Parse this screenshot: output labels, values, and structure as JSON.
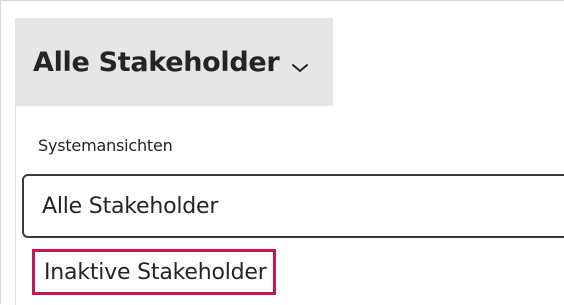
{
  "view_selector": {
    "label": "Alle Stakeholder",
    "chevron_icon": "chevron-down-icon"
  },
  "dropdown": {
    "group_header": "Systemansichten",
    "options": [
      {
        "label": "Alle Stakeholder",
        "state": "selected"
      },
      {
        "label": "Inaktive Stakeholder",
        "state": "highlighted"
      }
    ]
  },
  "colors": {
    "selector_background": "#e6e6e6",
    "highlight_border": "#c2185b",
    "selected_border": "#3a3a3a"
  }
}
